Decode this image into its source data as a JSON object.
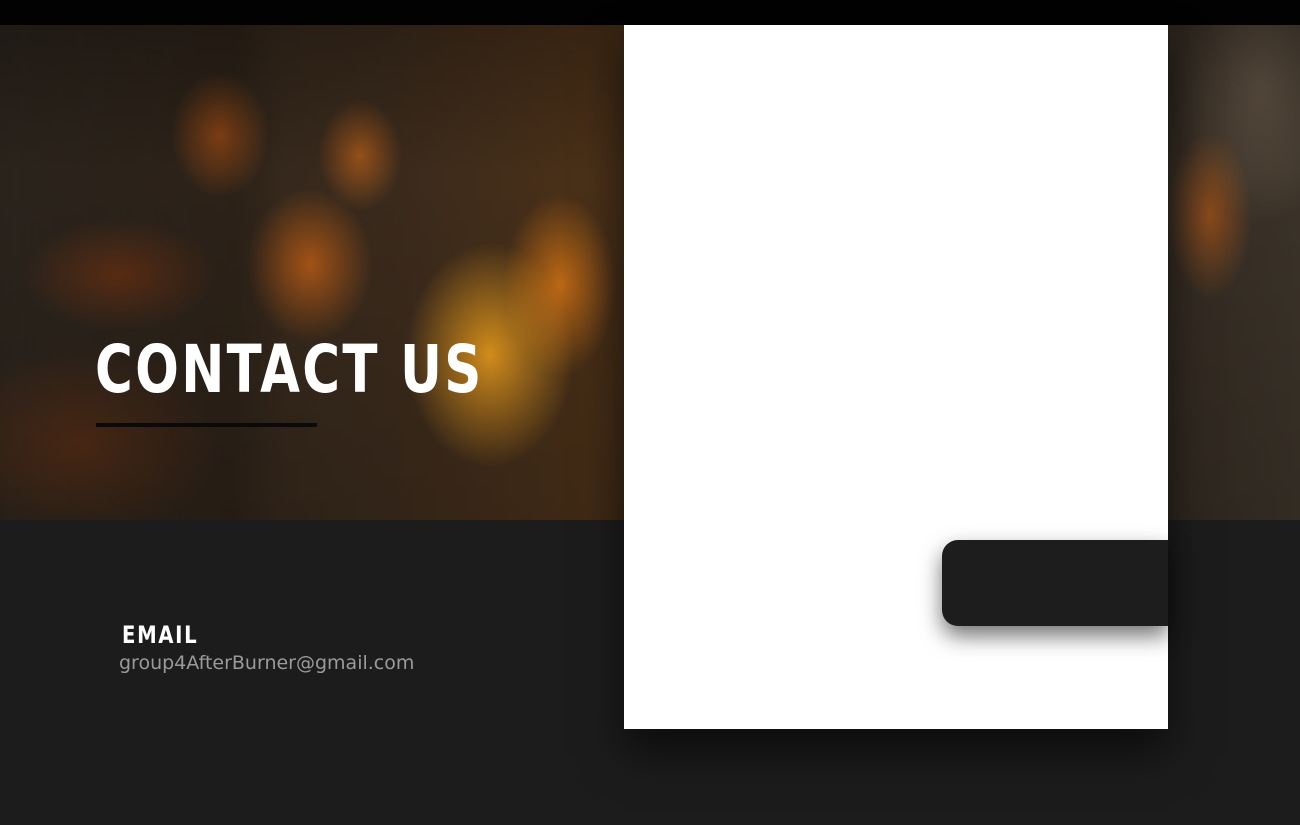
{
  "hero": {
    "title": "CONTACT US"
  },
  "contact": {
    "email_label": "EMAIL",
    "email_value": "group4AfterBurner@gmail.com"
  },
  "form": {
    "submit_label": ""
  },
  "colors": {
    "background": "#1c1c1c",
    "topbar": "#020202",
    "card": "#ffffff",
    "button": "#1d1d1d",
    "heading_text": "#ffffff",
    "muted_text": "#9a9a9a"
  }
}
